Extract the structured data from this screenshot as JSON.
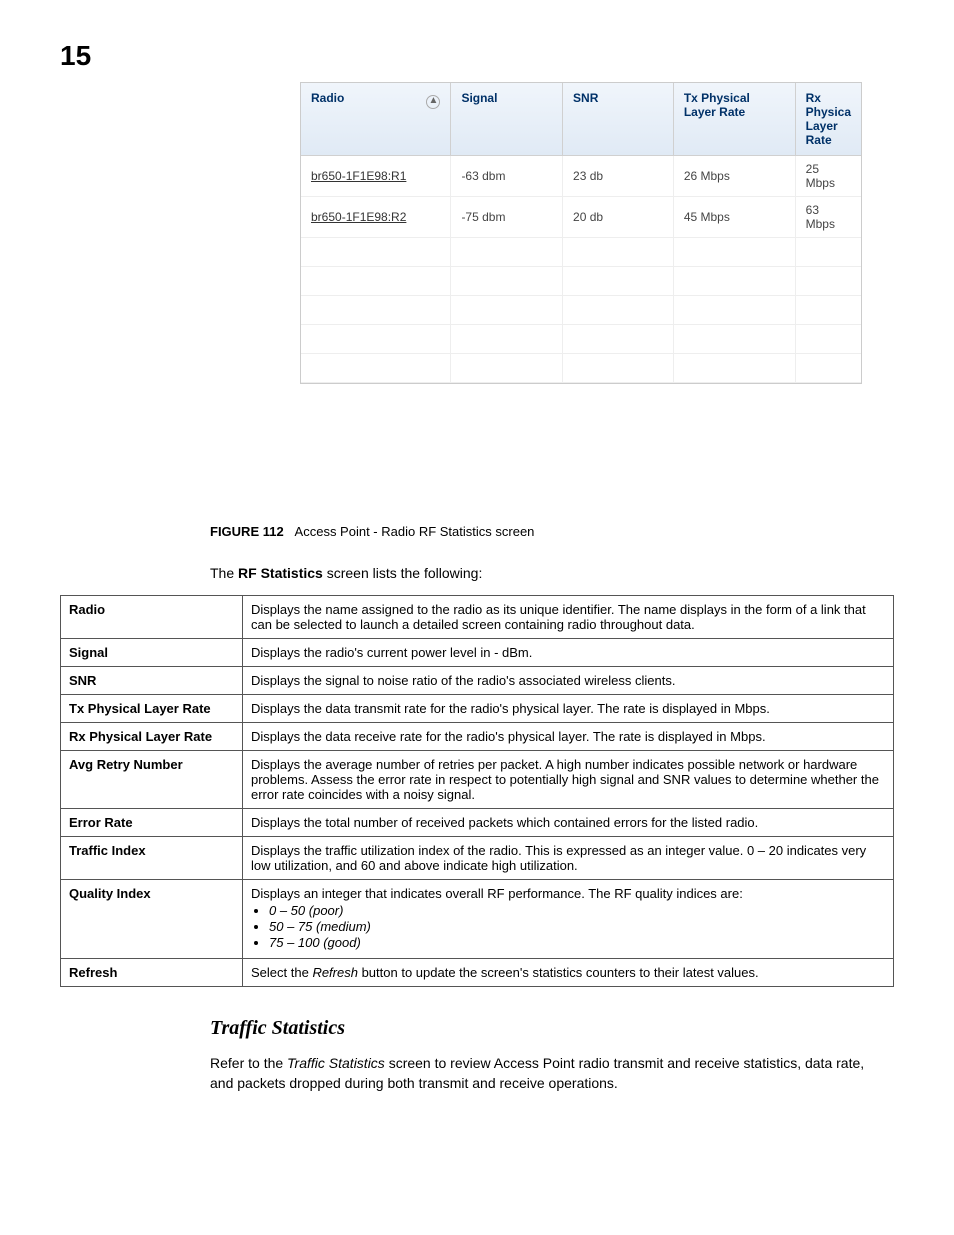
{
  "page_number": "15",
  "grid": {
    "headers": [
      "Radio",
      "Signal",
      "SNR",
      "Tx Physical Layer Rate",
      "Rx Physica Layer Rate"
    ],
    "rows": [
      {
        "radio": "br650-1F1E98:R1",
        "signal": "-63 dbm",
        "snr": "23 db",
        "tx": "26 Mbps",
        "rx": "25 Mbps"
      },
      {
        "radio": "br650-1F1E98:R2",
        "signal": "-75 dbm",
        "snr": "20 db",
        "tx": "45 Mbps",
        "rx": "63 Mbps"
      }
    ]
  },
  "figure": {
    "label": "FIGURE 112",
    "caption": "Access Point - Radio RF Statistics screen"
  },
  "intro": {
    "prefix": "The ",
    "bold": "RF Statistics",
    "suffix": " screen lists the following:"
  },
  "definitions": [
    {
      "term": "Radio",
      "desc": "Displays the name assigned to the radio as its unique identifier. The name displays in the form of a link that can be selected to launch a detailed screen containing radio throughout data."
    },
    {
      "term": "Signal",
      "desc": "Displays the radio's current power level in - dBm."
    },
    {
      "term": "SNR",
      "desc": "Displays the signal to noise ratio of the radio's associated wireless clients."
    },
    {
      "term": "Tx Physical Layer Rate",
      "desc": "Displays the data transmit rate for the radio's physical layer. The rate is displayed in Mbps."
    },
    {
      "term": "Rx Physical Layer Rate",
      "desc": "Displays the data receive rate for the radio's physical layer. The rate is displayed in Mbps."
    },
    {
      "term": "Avg Retry Number",
      "desc": "Displays the average number of retries per packet. A high number indicates possible network or hardware problems. Assess the error rate in respect to potentially high signal and SNR values to determine whether the error rate coincides with a noisy signal."
    },
    {
      "term": "Error Rate",
      "desc": "Displays the total number of received packets which contained errors for the listed radio."
    },
    {
      "term": "Traffic Index",
      "desc": "Displays the traffic utilization index of the radio. This is expressed as an integer value. 0 – 20 indicates very low utilization, and 60 and above indicate high utilization."
    },
    {
      "term": "Quality Index",
      "desc": "Displays an integer that indicates overall RF performance. The RF quality indices are:",
      "list": [
        "0 – 50 (poor)",
        "50 – 75 (medium)",
        "75 – 100 (good)"
      ]
    },
    {
      "term": "Refresh",
      "desc_pre": "Select the ",
      "desc_italic": "Refresh",
      "desc_post": " button to update the screen's statistics counters to their latest values."
    }
  ],
  "section_heading": "Traffic Statistics",
  "body": {
    "pre": "Refer to the ",
    "italic": "Traffic Statistics",
    "post": " screen to review Access Point radio transmit and receive statistics, data rate, and packets dropped during both transmit and receive operations."
  }
}
